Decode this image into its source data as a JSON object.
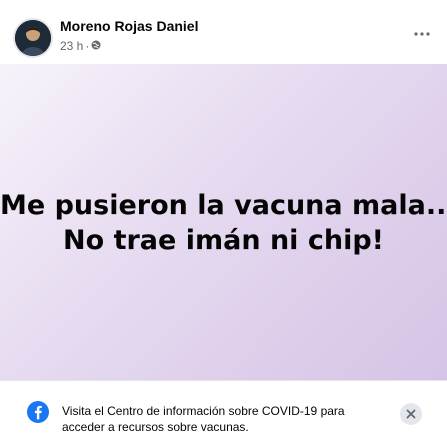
{
  "post": {
    "author_name": "Moreno Rojas Daniel",
    "timestamp": "23 h",
    "separator": "·",
    "privacy_icon": "globe-icon",
    "more_icon": "more-horizontal-icon",
    "text_line_1": "Me pusieron la vacuna mala...",
    "text_line_2": "No trae imán ni chip!"
  },
  "covid_notice": {
    "line_1": "Visita el Centro de información sobre COVID-19 para",
    "line_2": "acceder a recursos sobre vacunas.",
    "icon": "facebook-logo-icon",
    "close_icon": "close-icon"
  },
  "colors": {
    "facebook_blue": "#1877f2",
    "post_background": "#dccdea",
    "secondary_text": "#65676b"
  }
}
